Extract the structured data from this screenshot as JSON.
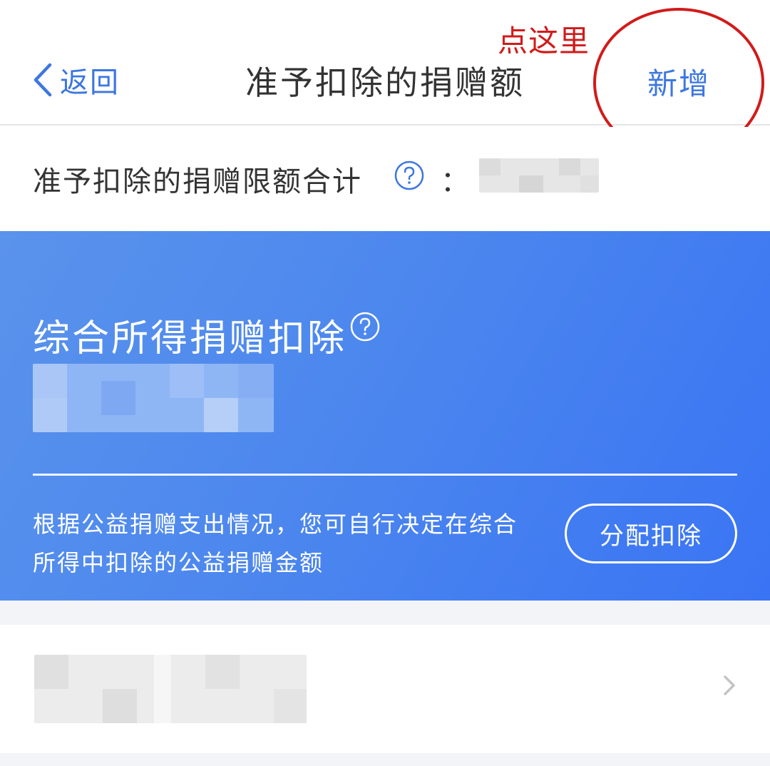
{
  "nav": {
    "back_label": "返回",
    "title": "准予扣除的捐赠额",
    "add_label": "新增"
  },
  "annotation": {
    "text": "点这里",
    "color": "#d11b1b"
  },
  "limit": {
    "label": "准予扣除的捐赠限额合计",
    "colon": "："
  },
  "card": {
    "title": "综合所得捐赠扣除",
    "description": "根据公益捐赠支出情况，您可自行决定在综合所得中扣除的公益捐赠金额",
    "allocate_button": "分配扣除"
  },
  "colors": {
    "accent": "#3d77e0",
    "card_start": "#5a93ec",
    "card_end": "#3a74f4"
  },
  "icons": [
    "chevron-left-icon",
    "help-circle-icon",
    "chevron-right-icon"
  ]
}
